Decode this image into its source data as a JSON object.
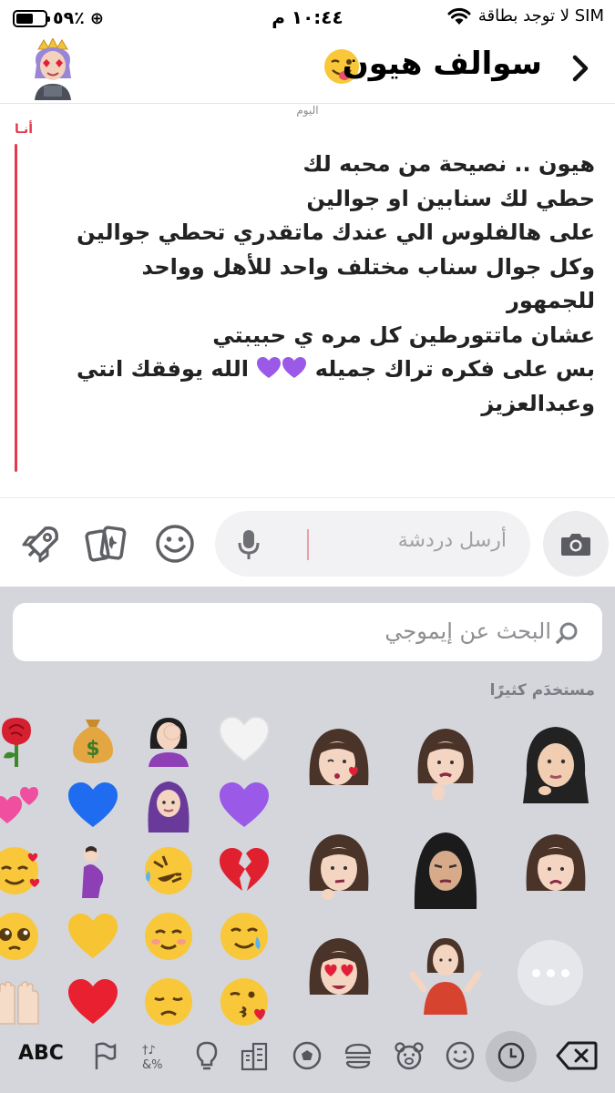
{
  "status_bar": {
    "battery": "٥٩٪",
    "battery_level": 0.59,
    "time": "١٠:٤٤ م",
    "carrier": "لا توجد بطاقة SIM"
  },
  "header": {
    "title": "سوالف هيون"
  },
  "chat": {
    "day_label": "اليوم",
    "sender": "أنـا",
    "accent_color": "#e3394b",
    "message_lines": [
      "هيون .. نصيحة من محبه لك",
      "حطي لك سنابين او جوالين",
      "على هالفلوس الي عندك ماتقدري تحطي جوالين",
      "وكل جوال سناب مختلف واحد للأهل وواحد",
      "للجمهور",
      "عشان ماتتورطين كل مره ي حبيبتي"
    ],
    "heart_line_before": "بس على فكره تراك جميله",
    "heart_line_after": "الله يوفقك انتي",
    "message_last_line": "وعبدالعزيز"
  },
  "input_bar": {
    "placeholder": "أرسل دردشة"
  },
  "keyboard": {
    "search_placeholder": "البحث عن إيموجي",
    "frequently_used_label": "مستخدَم كثيرًا",
    "abc_label": "ABC"
  }
}
